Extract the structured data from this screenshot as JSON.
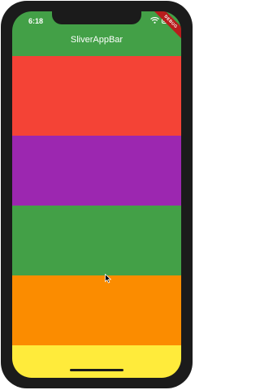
{
  "status_bar": {
    "time": "6:18",
    "wifi_icon": "wifi-icon",
    "battery_icon": "battery-icon"
  },
  "app_bar": {
    "title": "SliverAppBar",
    "color": "#43a047"
  },
  "debug_banner": {
    "label": "DEBUG",
    "color": "#b71c1c"
  },
  "list": {
    "items": [
      {
        "color": "#f44336"
      },
      {
        "color": "#9c27b0"
      },
      {
        "color": "#43a047"
      },
      {
        "color": "#fb8c00"
      },
      {
        "color": "#ffeb3b"
      }
    ]
  }
}
